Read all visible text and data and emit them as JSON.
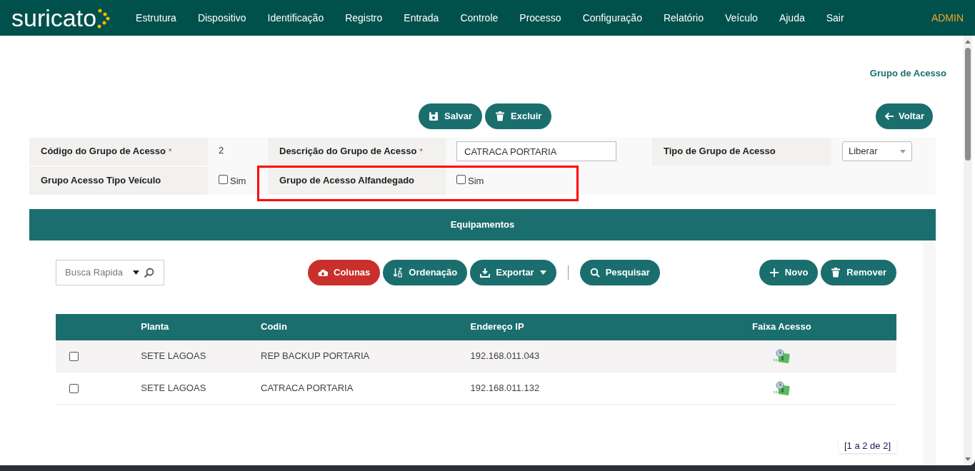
{
  "brand": {
    "logo": "suricato"
  },
  "menu": [
    {
      "label": "Estrutura"
    },
    {
      "label": "Dispositivo"
    },
    {
      "label": "Identificação"
    },
    {
      "label": "Registro"
    },
    {
      "label": "Entrada"
    },
    {
      "label": "Controle"
    },
    {
      "label": "Processo"
    },
    {
      "label": "Configuração"
    },
    {
      "label": "Relatório"
    },
    {
      "label": "Veículo"
    },
    {
      "label": "Ajuda"
    },
    {
      "label": "Sair"
    }
  ],
  "user": "ADMIN",
  "page_title": "Grupo de Acesso",
  "actions": [
    {
      "label": "Salvar",
      "kind": "save"
    },
    {
      "label": "Excluir",
      "kind": "delete"
    }
  ],
  "back_button": {
    "label": "Voltar"
  },
  "form": {
    "rows": [
      [
        {
          "label": "Código do Grupo de Acesso",
          "required_mark": "*",
          "kind": "text",
          "value": "2"
        },
        {
          "label": "Descrição do Grupo de Acesso",
          "required_mark": "*",
          "kind": "input",
          "value": "CATRACA PORTARIA"
        },
        {
          "label": "Tipo de Grupo de Acesso",
          "kind": "select",
          "value": "Liberar"
        }
      ],
      [
        {
          "label": "Grupo Acesso Tipo Veículo",
          "kind": "checkbox",
          "option": "Sim",
          "checked": false
        },
        {
          "label": "Grupo de Acesso Alfandegado",
          "kind": "checkbox",
          "option": "Sim",
          "checked": false,
          "highlighted": true
        }
      ]
    ]
  },
  "section": {
    "title": "Equipamentos",
    "search": {
      "placeholder": "Busca Rapida"
    },
    "toolbar": [
      {
        "label": "Colunas",
        "kind": "columns"
      },
      {
        "label": "Ordenação",
        "kind": "sort"
      },
      {
        "label": "Exportar",
        "kind": "export"
      },
      {
        "label": "Pesquisar",
        "kind": "search"
      }
    ],
    "right_actions": [
      {
        "label": "Novo",
        "kind": "new"
      },
      {
        "label": "Remover",
        "kind": "remove"
      }
    ],
    "table": {
      "columns": [
        "Planta",
        "Codin",
        "Endereço IP",
        "Faixa Acesso"
      ],
      "rows": [
        {
          "selected": false,
          "cells": [
            "SETE LAGOAS",
            "REP BACKUP PORTARIA",
            "192.168.011.043"
          ]
        },
        {
          "selected": false,
          "cells": [
            "SETE LAGOAS",
            "CATRACA PORTARIA",
            "192.168.011.132"
          ]
        }
      ]
    },
    "pagination": "[1 a 2 de 2]"
  }
}
